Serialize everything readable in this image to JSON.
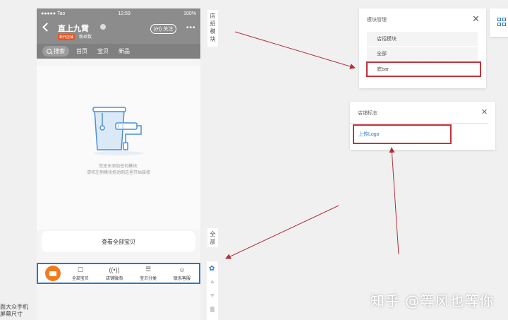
{
  "phone": {
    "status": {
      "carrier": "●●●●● Tao",
      "time": "12:59",
      "battery": "100%"
    },
    "shop": {
      "name": "直上九霄",
      "badge": "新开店铺",
      "fans": "粉丝数",
      "follow": "关注"
    },
    "nav": {
      "search": "搜索",
      "links": [
        "首页",
        "宝贝",
        "新品"
      ]
    },
    "empty_text": [
      "您还未添加任何模块.",
      "请将左侧模块拖动到这里开始装修"
    ],
    "view_all": "查看全部宝贝",
    "tabs": [
      {
        "label": "全部宝贝",
        "icon": "bag-icon"
      },
      {
        "label": "店铺微淘",
        "icon": "broadcast-icon"
      },
      {
        "label": "宝贝分类",
        "icon": "list-icon"
      },
      {
        "label": "联系客服",
        "icon": "chat-icon"
      }
    ]
  },
  "side": {
    "shop_tab": "店招模块",
    "all_tab": "全部"
  },
  "module_panel": {
    "title": "模块管理",
    "close": "✕",
    "items": [
      "店招模块",
      "全部",
      "底bar"
    ]
  },
  "logo_panel": {
    "title": "店铺标志",
    "close": "✕",
    "upload": "上传Logo"
  },
  "watermark": "知乎 @等风也等你",
  "corner": {
    "line1": "面大众手机",
    "line2": "屏幕尺寸"
  },
  "colors": {
    "highlight": "#c0333a",
    "accent": "#2a76c9",
    "brand": "#f37b1d"
  }
}
